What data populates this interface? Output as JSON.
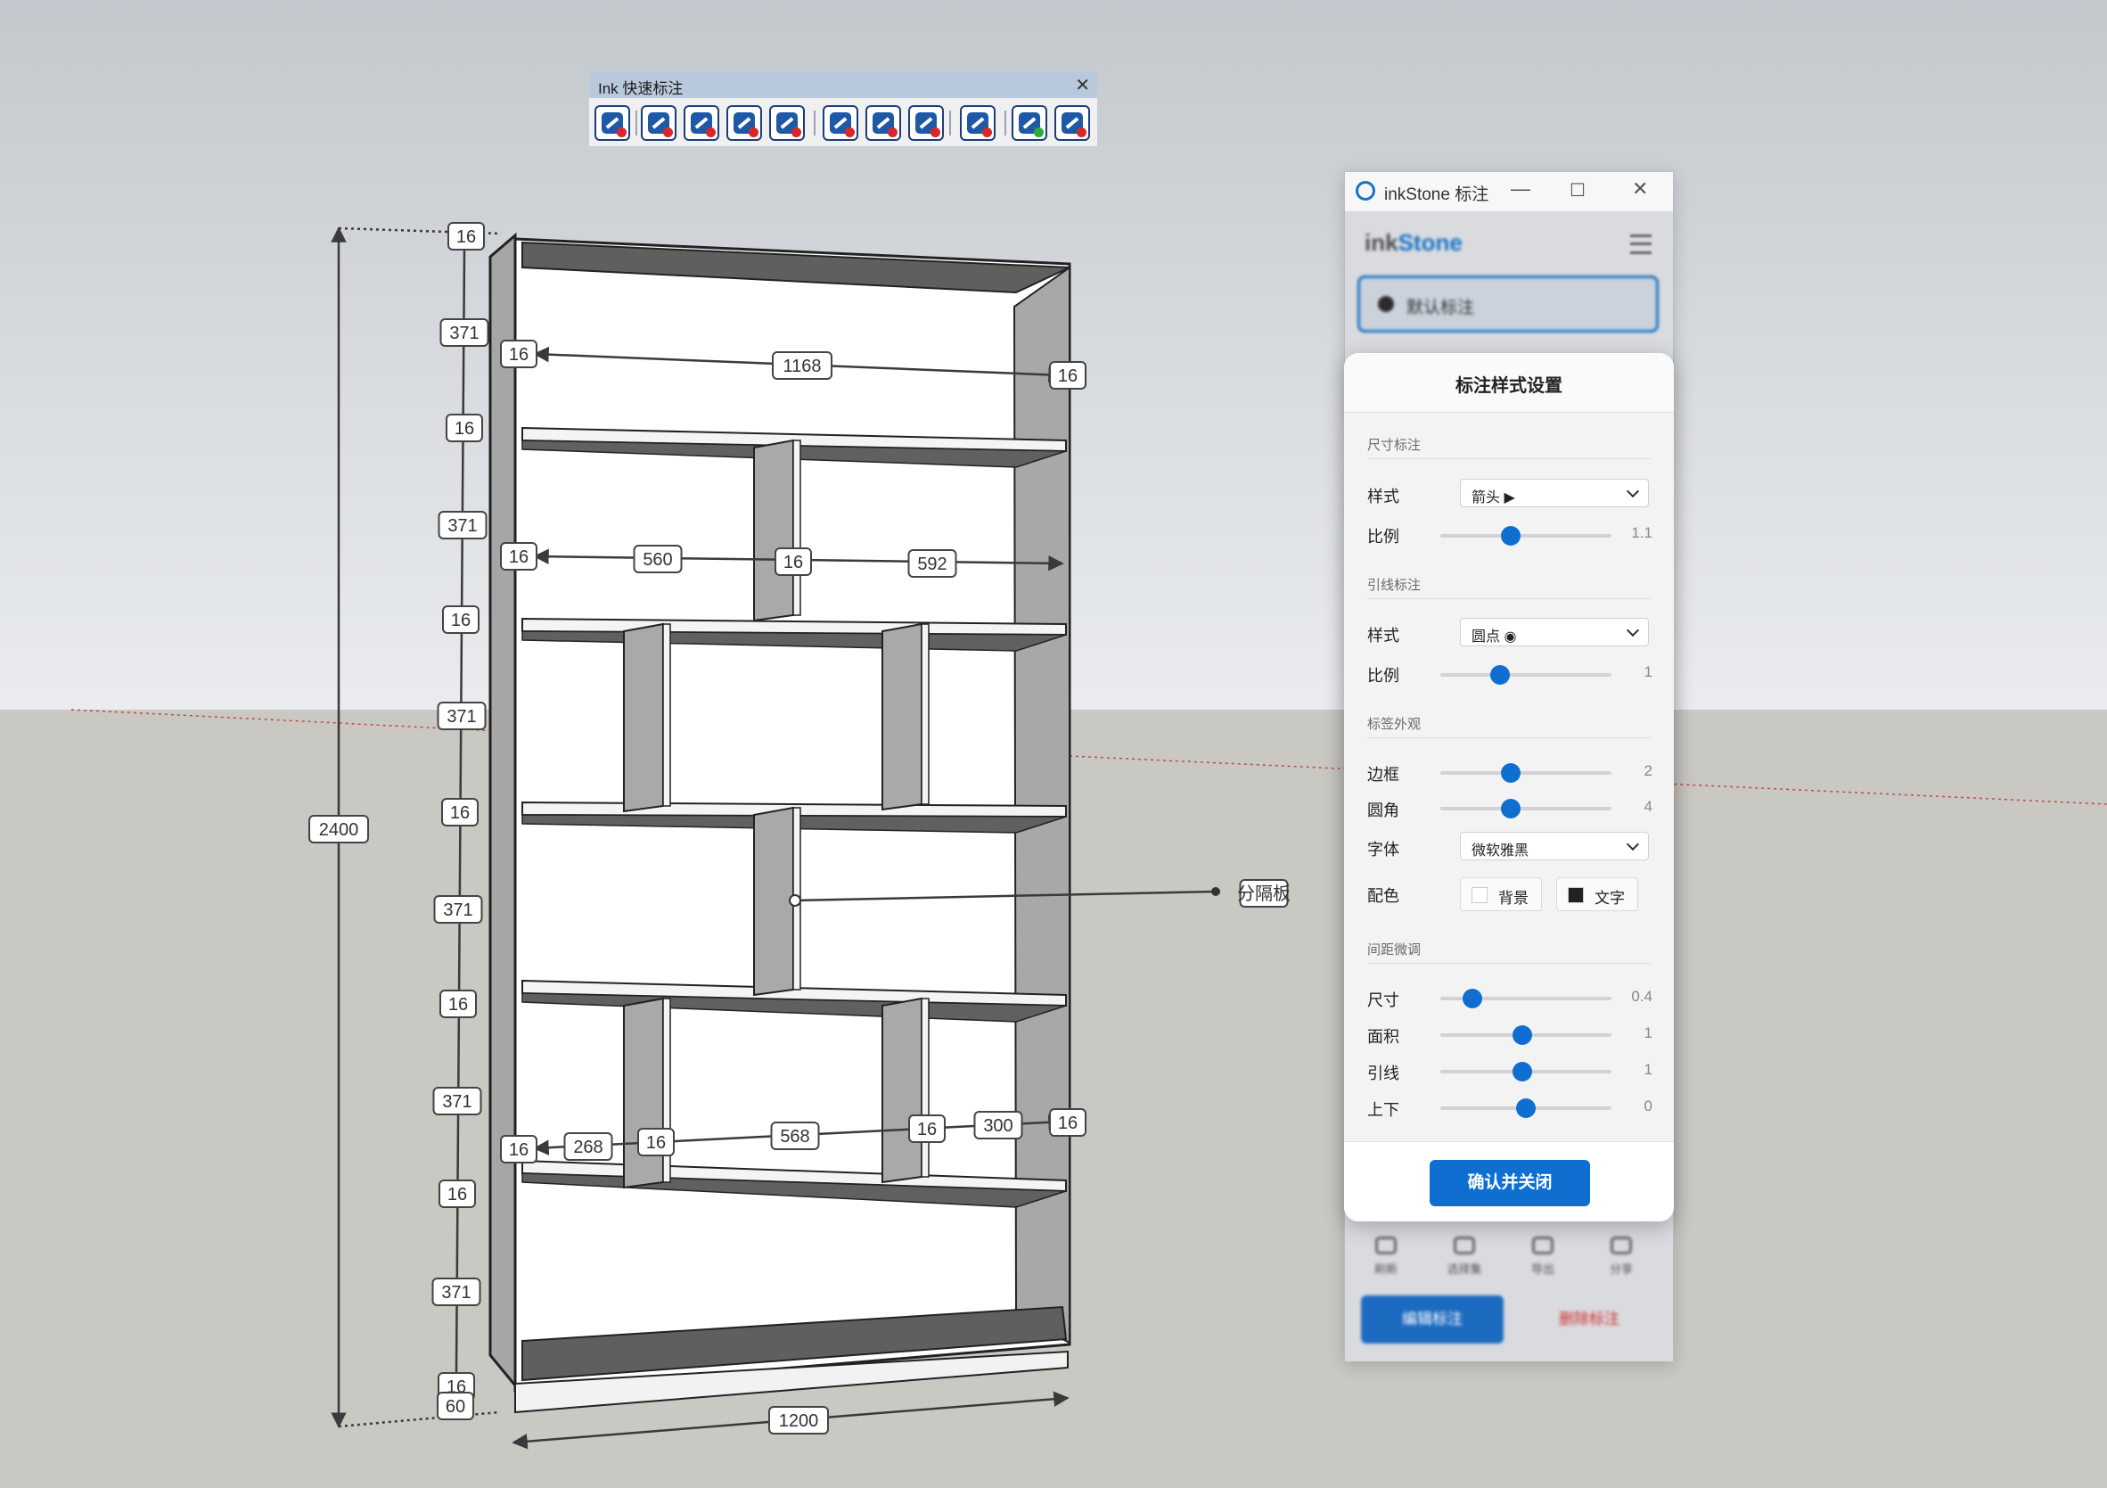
{
  "toolbar": {
    "title": "Ink 快速标注",
    "close_glyph": "✕",
    "buttons": [
      {
        "icon": "dimension-auto-icon",
        "accent": "#d62828"
      },
      {
        "icon": "dimension-linear-icon",
        "accent": "#d62828"
      },
      {
        "icon": "dimension-aligned-icon",
        "accent": "#d62828"
      },
      {
        "icon": "dimension-chain-icon",
        "accent": "#d62828"
      },
      {
        "icon": "dimension-baseline-icon",
        "accent": "#d62828"
      },
      {
        "icon": "area-label-icon",
        "accent": "#d62828"
      },
      {
        "icon": "face-label-icon",
        "accent": "#d62828"
      },
      {
        "icon": "surface-label-icon",
        "accent": "#d62828"
      },
      {
        "icon": "text-leader-icon",
        "accent": "#d62828"
      },
      {
        "icon": "show-labels-icon",
        "accent": "#2eaa3a"
      },
      {
        "icon": "delete-labels-icon",
        "accent": "#d62828"
      }
    ]
  },
  "model": {
    "dimensions_left": [
      "16",
      "371",
      "16",
      "371",
      "16",
      "371",
      "16",
      "371",
      "16",
      "371",
      "16",
      "371",
      "16",
      "60"
    ],
    "overall_height": "2400",
    "overall_width": "1200",
    "row1": [
      "16",
      "1168",
      "16"
    ],
    "row2": [
      "16",
      "560",
      "16",
      "592"
    ],
    "row5": [
      "16",
      "268",
      "16",
      "568",
      "16",
      "300",
      "16"
    ],
    "leader_label": "分隔板"
  },
  "panel": {
    "title": "inkStone 标注",
    "brand_ink": "ink",
    "brand_stone": "Stone",
    "layer_label": "默认标注",
    "bottom_icons": [
      "刷新",
      "选择集",
      "导出",
      "分享"
    ],
    "edit_button": "编辑标注",
    "delete_button": "删除标注",
    "accent": "#0f6fd1",
    "modal": {
      "title": "标注样式设置",
      "sections": {
        "dimension": "尺寸标注",
        "leader": "引线标注",
        "tag": "标签外观",
        "spacing": "间距微调"
      },
      "dim_style_label": "样式",
      "dim_style_value": "箭头 ▶",
      "dim_scale_label": "比例",
      "dim_scale_value": "1.1",
      "dim_scale_fraction": 0.41,
      "leader_style_label": "样式",
      "leader_style_value": "圆点 ◉",
      "leader_scale_label": "比例",
      "leader_scale_value": "1",
      "leader_scale_fraction": 0.35,
      "border_label": "边框",
      "border_value": "2",
      "border_fraction": 0.41,
      "radius_label": "圆角",
      "radius_value": "4",
      "radius_fraction": 0.41,
      "font_label": "字体",
      "font_value": "微软雅黑",
      "color_label": "配色",
      "bg_label": "背景",
      "bg_color": "#ffffff",
      "text_label": "文字",
      "text_color": "#222222",
      "size_label": "尺寸",
      "size_value": "0.4",
      "size_fraction": 0.19,
      "area_label": "面积",
      "area_value": "1",
      "area_fraction": 0.48,
      "leader2_label": "引线",
      "leader2_value": "1",
      "leader2_fraction": 0.48,
      "updown_label": "上下",
      "updown_value": "0",
      "updown_fraction": 0.5,
      "confirm": "确认并关闭"
    }
  }
}
